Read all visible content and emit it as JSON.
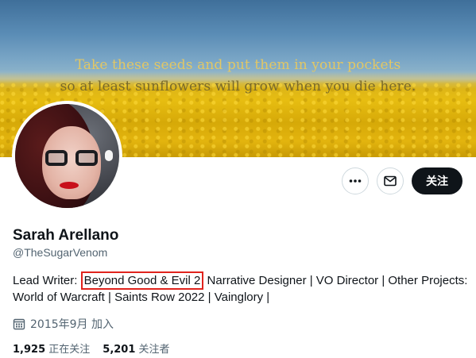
{
  "banner": {
    "quote_line1": "Take these seeds and put them in your pockets",
    "quote_line2": "so at least sunflowers will grow when you die here."
  },
  "profile": {
    "name": "Sarah Arellano",
    "handle": "@TheSugarVenom",
    "bio_prefix": "Lead Writer: ",
    "bio_highlight": "Beyond Good & Evil 2",
    "bio_suffix_line1": " Narrative Designer | VO Director | Other Projects:",
    "bio_line2": "World of Warcraft | Saints Row 2022 | Vainglory |",
    "joined": "2015年9月 加入",
    "following_count": "1,925",
    "following_label": "正在关注",
    "followers_count": "5,201",
    "followers_label": "关注者"
  },
  "actions": {
    "more_icon": "more-dots-icon",
    "message_icon": "envelope-icon",
    "follow_label": "关注"
  },
  "colors": {
    "follow_button_bg": "#0f1419",
    "highlight_border": "#e0231d",
    "secondary_text": "#536471"
  }
}
